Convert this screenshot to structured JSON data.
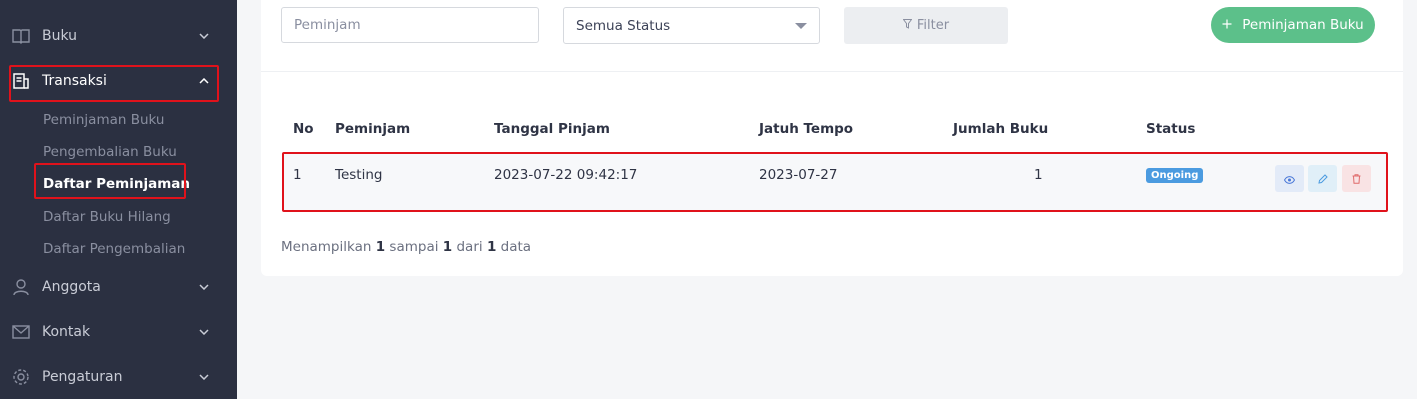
{
  "sidebar": {
    "items": [
      {
        "label": "Buku",
        "icon": "book-icon"
      },
      {
        "label": "Transaksi",
        "icon": "receipt-icon"
      },
      {
        "label": "Anggota",
        "icon": "user-icon"
      },
      {
        "label": "Kontak",
        "icon": "mail-icon"
      },
      {
        "label": "Pengaturan",
        "icon": "gear-icon"
      }
    ],
    "transaksi_sub": [
      "Peminjaman Buku",
      "Pengembalian Buku",
      "Daftar Peminjaman",
      "Daftar Buku Hilang",
      "Daftar Pengembalian"
    ]
  },
  "toolbar": {
    "search_placeholder": "Peminjam",
    "status_select": "Semua Status",
    "filter_label": "Filter",
    "add_label": "Peminjaman Buku"
  },
  "table": {
    "headers": [
      "No",
      "Peminjam",
      "Tanggal Pinjam",
      "Jatuh Tempo",
      "Jumlah Buku",
      "Status"
    ],
    "rows": [
      {
        "no": "1",
        "peminjam": "Testing",
        "tanggal_pinjam": "2023-07-22 09:42:17",
        "jatuh_tempo": "2023-07-27",
        "jumlah_buku": "1",
        "status": "Ongoing"
      }
    ]
  },
  "footer": {
    "prefix": "Menampilkan",
    "from": "1",
    "mid1": "sampai",
    "to": "1",
    "mid2": "dari",
    "total": "1",
    "suffix": "data"
  },
  "colors": {
    "sidebar_bg": "#2b3041",
    "accent_green": "#5cc08a",
    "status_badge": "#4b9be0",
    "highlight": "#e0121b"
  }
}
